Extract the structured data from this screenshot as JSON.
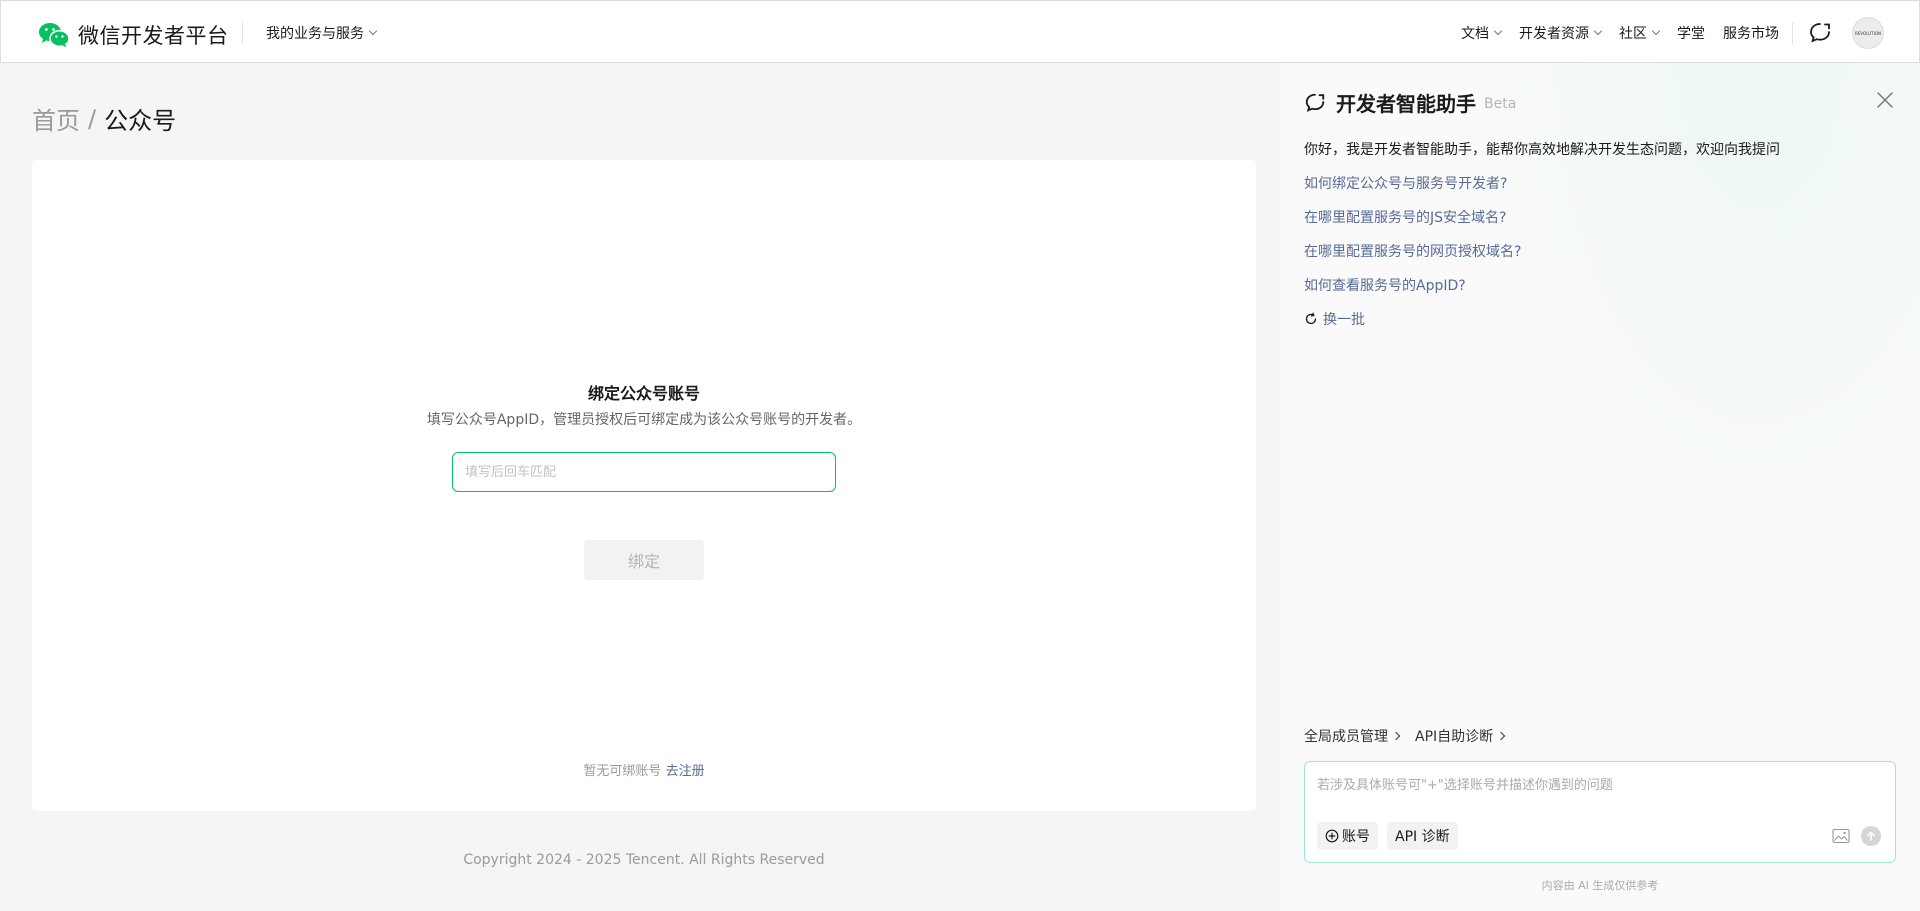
{
  "header": {
    "logo_text": "微信开发者平台",
    "my_services": "我的业务与服务",
    "nav": [
      {
        "label": "文档",
        "dropdown": true
      },
      {
        "label": "开发者资源",
        "dropdown": true
      },
      {
        "label": "社区",
        "dropdown": true
      },
      {
        "label": "学堂",
        "dropdown": false
      },
      {
        "label": "服务市场",
        "dropdown": false
      }
    ],
    "avatar_text": "REVOLUTION"
  },
  "breadcrumb": {
    "home": "首页",
    "separator": "/",
    "current": "公众号"
  },
  "bind": {
    "title": "绑定公众号账号",
    "description": "填写公众号AppID，管理员授权后可绑定成为该公众号账号的开发者。",
    "input_placeholder": "填写后回车匹配",
    "input_value": "",
    "button_label": "绑定",
    "no_account_text": "暂无可绑账号",
    "register_link": "去注册"
  },
  "footer": {
    "copyright": "Copyright 2024 - 2025 Tencent. All Rights Reserved"
  },
  "assistant": {
    "title": "开发者智能助手",
    "beta": "Beta",
    "welcome": "你好，我是开发者智能助手，能帮你高效地解决开发生态问题，欢迎向我提问",
    "suggestions": [
      "如何绑定公众号与服务号开发者?",
      "在哪里配置服务号的JS安全域名?",
      "在哪里配置服务号的网页授权域名?",
      "如何查看服务号的AppID?"
    ],
    "refresh_label": "换一批",
    "quick_links": [
      "全局成员管理",
      "API自助诊断"
    ],
    "input_placeholder": "若涉及具体账号可\"+\"选择账号并描述你遇到的问题",
    "chip_account": "账号",
    "chip_api": "API 诊断",
    "disclaimer": "内容由 AI 生成仅供参考"
  },
  "colors": {
    "brand_green": "#07c160",
    "link_blue": "#576b95",
    "chat_border": "#9fe3d3"
  },
  "icons": [
    "wechat-logo-icon",
    "chevron-down-icon",
    "chat-bubble-icon",
    "close-icon",
    "refresh-icon",
    "chevron-right-icon",
    "plus-circle-icon",
    "image-icon",
    "send-arrow-icon"
  ]
}
